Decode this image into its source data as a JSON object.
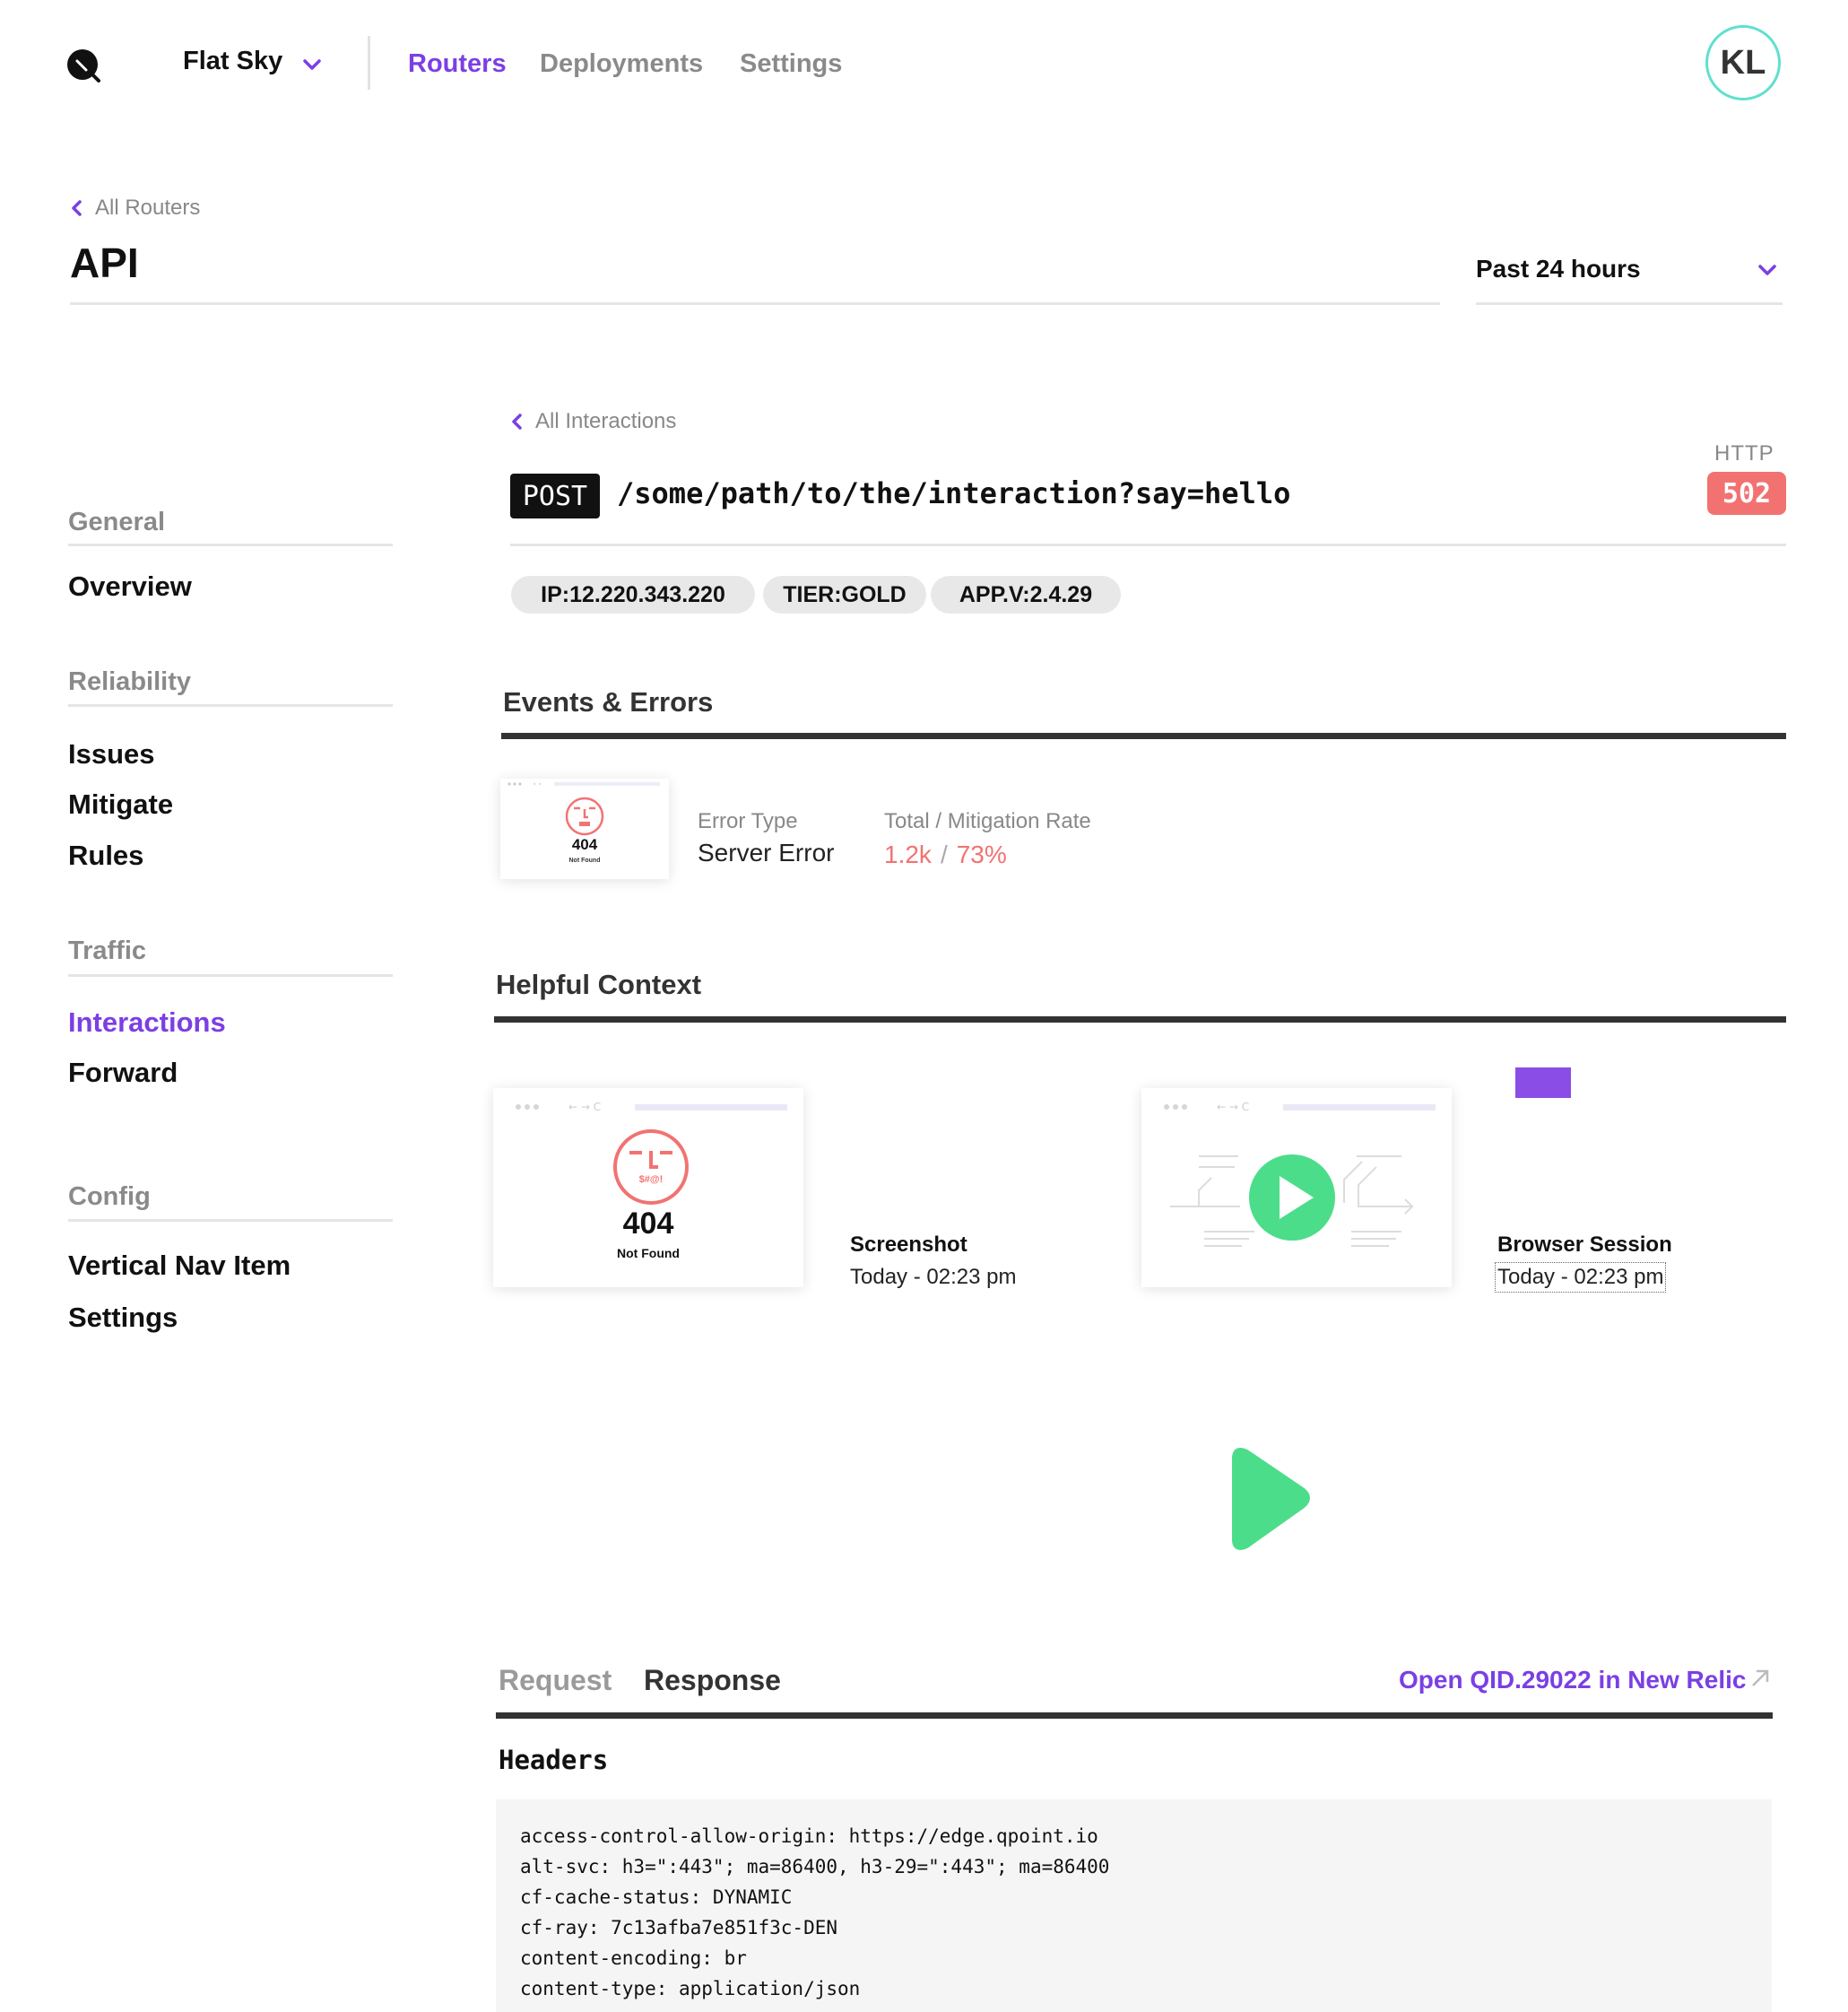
{
  "org": {
    "name": "Flat Sky"
  },
  "nav": {
    "routers": "Routers",
    "deployments": "Deployments",
    "settings": "Settings"
  },
  "user": {
    "initials": "KL"
  },
  "breadcrumb": {
    "label": "All Routers"
  },
  "page": {
    "title": "API"
  },
  "time_range": {
    "selected": "Past 24 hours"
  },
  "sidebar": {
    "general": {
      "heading": "General",
      "items": [
        "Overview"
      ]
    },
    "reliability": {
      "heading": "Reliability",
      "items": [
        "Issues",
        "Mitigate",
        "Rules"
      ]
    },
    "traffic": {
      "heading": "Traffic",
      "items": [
        "Interactions",
        "Forward"
      ]
    },
    "config": {
      "heading": "Config",
      "items": [
        "Vertical Nav Item",
        "Settings"
      ]
    }
  },
  "interaction": {
    "back_label": "All Interactions",
    "method": "POST",
    "path": "/some/path/to/the/interaction?say=hello",
    "http_label": "HTTP",
    "status": "502",
    "tags": [
      "IP:12.220.343.220",
      "TIER:GOLD",
      "APP.V:2.4.29"
    ]
  },
  "events": {
    "title": "Events & Errors",
    "thumb_code": "404",
    "thumb_text": "Not Found",
    "error_type_label": "Error Type",
    "error_type_value": "Server Error",
    "rate_label": "Total / Mitigation Rate",
    "total": "1.2k",
    "separator": "/",
    "mitigation_rate": "73%"
  },
  "context": {
    "title": "Helpful Context",
    "screenshot": {
      "face_text": "$#@!",
      "code": "404",
      "code_text": "Not Found",
      "title": "Screenshot",
      "time": "Today - 02:23 pm"
    },
    "session": {
      "title": "Browser Session",
      "time": "Today - 02:23 pm"
    }
  },
  "details": {
    "tab_request": "Request",
    "tab_response": "Response",
    "active_tab": "Response",
    "external_link": "Open QID.29022 in New Relic",
    "headers_title": "Headers",
    "headers": [
      "access-control-allow-origin: https://edge.qpoint.io",
      "alt-svc: h3=\":443\"; ma=86400, h3-29=\":443\"; ma=86400",
      "cf-cache-status: DYNAMIC",
      "cf-ray: 7c13afba7e851f3c-DEN",
      "content-encoding: br",
      "content-type: application/json"
    ]
  },
  "colors": {
    "accent": "#7b3fe4",
    "error": "#f27272",
    "play": "#4cdd8a",
    "avatar_ring": "#5fe0cf",
    "chip": "#8a4de6"
  }
}
